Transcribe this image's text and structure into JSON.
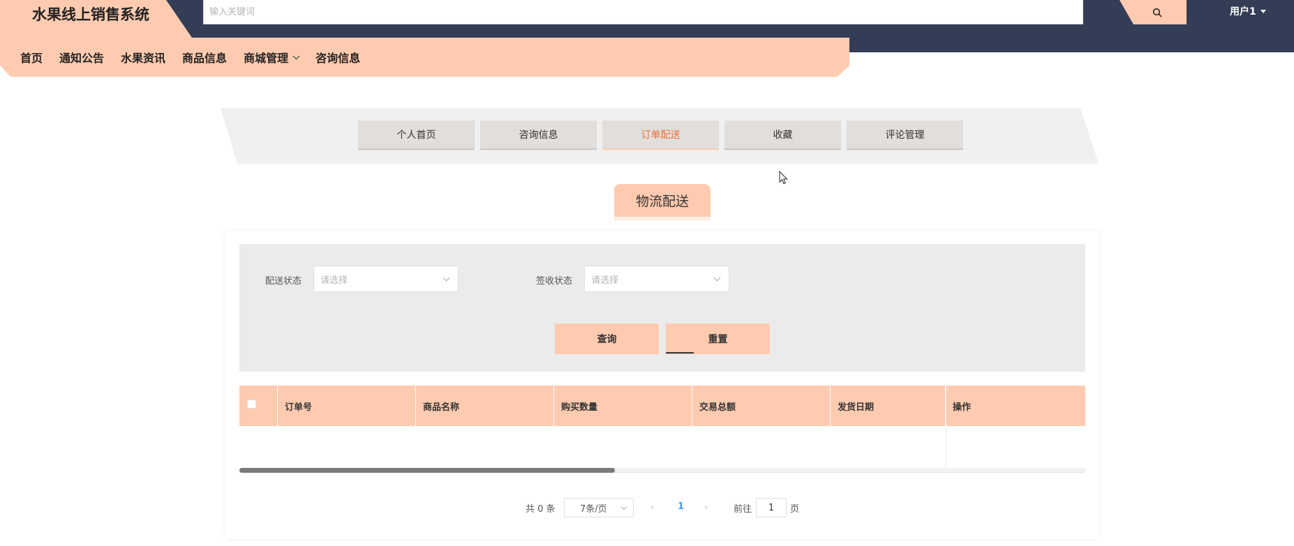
{
  "header": {
    "brand": "水果线上销售系统",
    "search_placeholder": "输入关键词",
    "user_label": "用户1"
  },
  "nav": {
    "items": [
      {
        "label": "首页"
      },
      {
        "label": "通知公告"
      },
      {
        "label": "水果资讯"
      },
      {
        "label": "商品信息"
      },
      {
        "label": "商城管理",
        "has_dropdown": true
      },
      {
        "label": "咨询信息"
      }
    ]
  },
  "tabs": {
    "items": [
      {
        "label": "个人首页"
      },
      {
        "label": "咨询信息"
      },
      {
        "label": "订单配送",
        "active": true
      },
      {
        "label": "收藏"
      },
      {
        "label": "评论管理"
      }
    ]
  },
  "section": {
    "title": "物流配送"
  },
  "filters": {
    "delivery_status_label": "配送状态",
    "delivery_status_placeholder": "请选择",
    "receipt_status_label": "签收状态",
    "receipt_status_placeholder": "请选择",
    "query_button": "查询",
    "reset_button": "重置"
  },
  "table": {
    "columns": [
      "订单号",
      "商品名称",
      "购买数量",
      "交易总额",
      "发货日期",
      "操作"
    ],
    "rows": []
  },
  "pagination": {
    "total_text": "共 0 条",
    "page_size": "7条/页",
    "current_page": "1",
    "goto_label": "前往",
    "goto_value": "1",
    "page_unit": "页"
  },
  "colors": {
    "accent": "#ffcbb0",
    "header_dark": "#333d55",
    "active_tab_text": "#e8703a",
    "page_number": "#409eff"
  }
}
